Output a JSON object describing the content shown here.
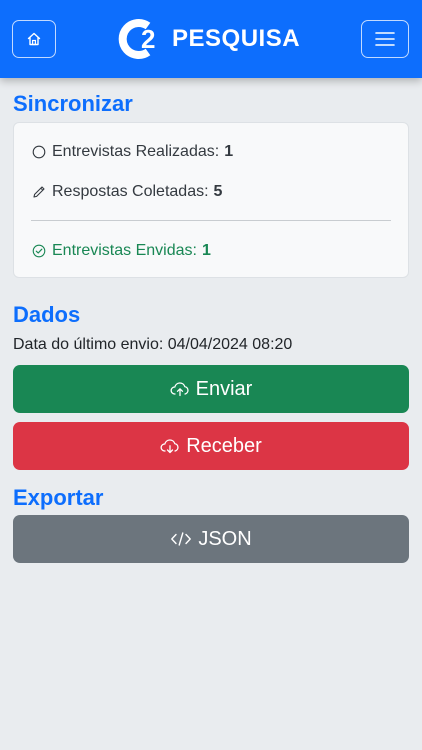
{
  "header": {
    "brand_mark": "2",
    "brand_name": "PESQUISA",
    "home_icon": "house-icon",
    "menu_icon": "hamburger-menu-icon",
    "color": "#0d6efd"
  },
  "sync": {
    "title": "Sincronizar",
    "items": [
      {
        "icon": "circle-icon",
        "label": "Entrevistas Realizadas:",
        "value": "1"
      },
      {
        "icon": "pencil-icon",
        "label": "Respostas Coletadas:",
        "value": "5"
      },
      {
        "icon": "check-circle-icon",
        "label": "Entrevistas Envidas:",
        "value": "1",
        "color": "#198754"
      }
    ]
  },
  "data_section": {
    "title": "Dados",
    "last_send": "Data do último envio: 04/04/2024 08:20",
    "send_label": "Enviar",
    "receive_label": "Receber",
    "send_color": "#198754",
    "receive_color": "#dc3545"
  },
  "export": {
    "title": "Exportar",
    "json_label": "JSON",
    "json_color": "#6c757d"
  }
}
